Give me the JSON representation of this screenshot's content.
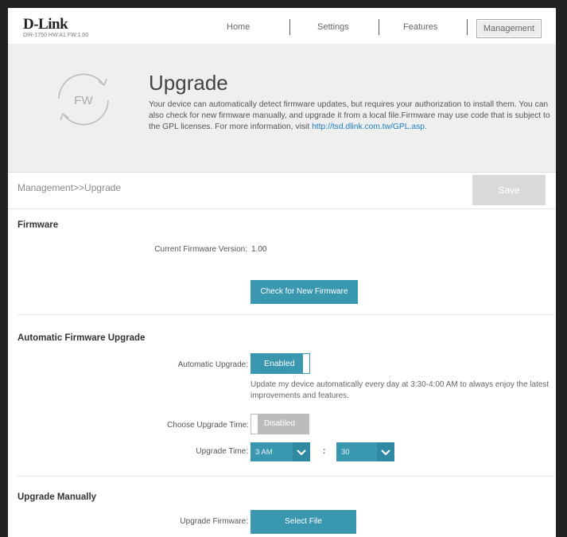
{
  "header": {
    "brand": "D-Link",
    "device_info": "DIR-1750 HW:A1 FW:1.00",
    "nav": [
      "Home",
      "Settings",
      "Features",
      "Management"
    ]
  },
  "banner": {
    "icon_label": "FW",
    "title": "Upgrade",
    "desc_text": "Your device can automatically detect firmware updates, but requires your authorization to install them. You can also check for new firmware manually, and upgrade it from a local file.Firmware may use code that is subject to the GPL licenses. For more information, visit ",
    "desc_link": "http://tsd.dlink.com.tw/GPL.asp."
  },
  "breadcrumb": "Management>>Upgrade",
  "save_label": "Save",
  "firmware": {
    "title": "Firmware",
    "current_label": "Current Firmware Version:",
    "current_value": "1.00",
    "check_button": "Check for New Firmware"
  },
  "auto": {
    "title": "Automatic Firmware Upgrade",
    "auto_label": "Automatic Upgrade:",
    "auto_state": "Enabled",
    "note": "Update my device automatically every day at 3:30-4:00 AM to always enjoy the latest improvements and features.",
    "time_label": "Choose Upgrade Time:",
    "time_state": "Disabled",
    "upgrade_time_label": "Upgrade Time:",
    "hour": "3 AM",
    "separator": ":",
    "minute": "30"
  },
  "manual": {
    "title": "Upgrade Manually",
    "label": "Upgrade Firmware:",
    "button": "Select File"
  },
  "colors": {
    "accent": "#3a97b0",
    "save_disabled": "#d9d9d9",
    "toggle_off": "#bcbcbc",
    "link": "#1a7fbf"
  }
}
